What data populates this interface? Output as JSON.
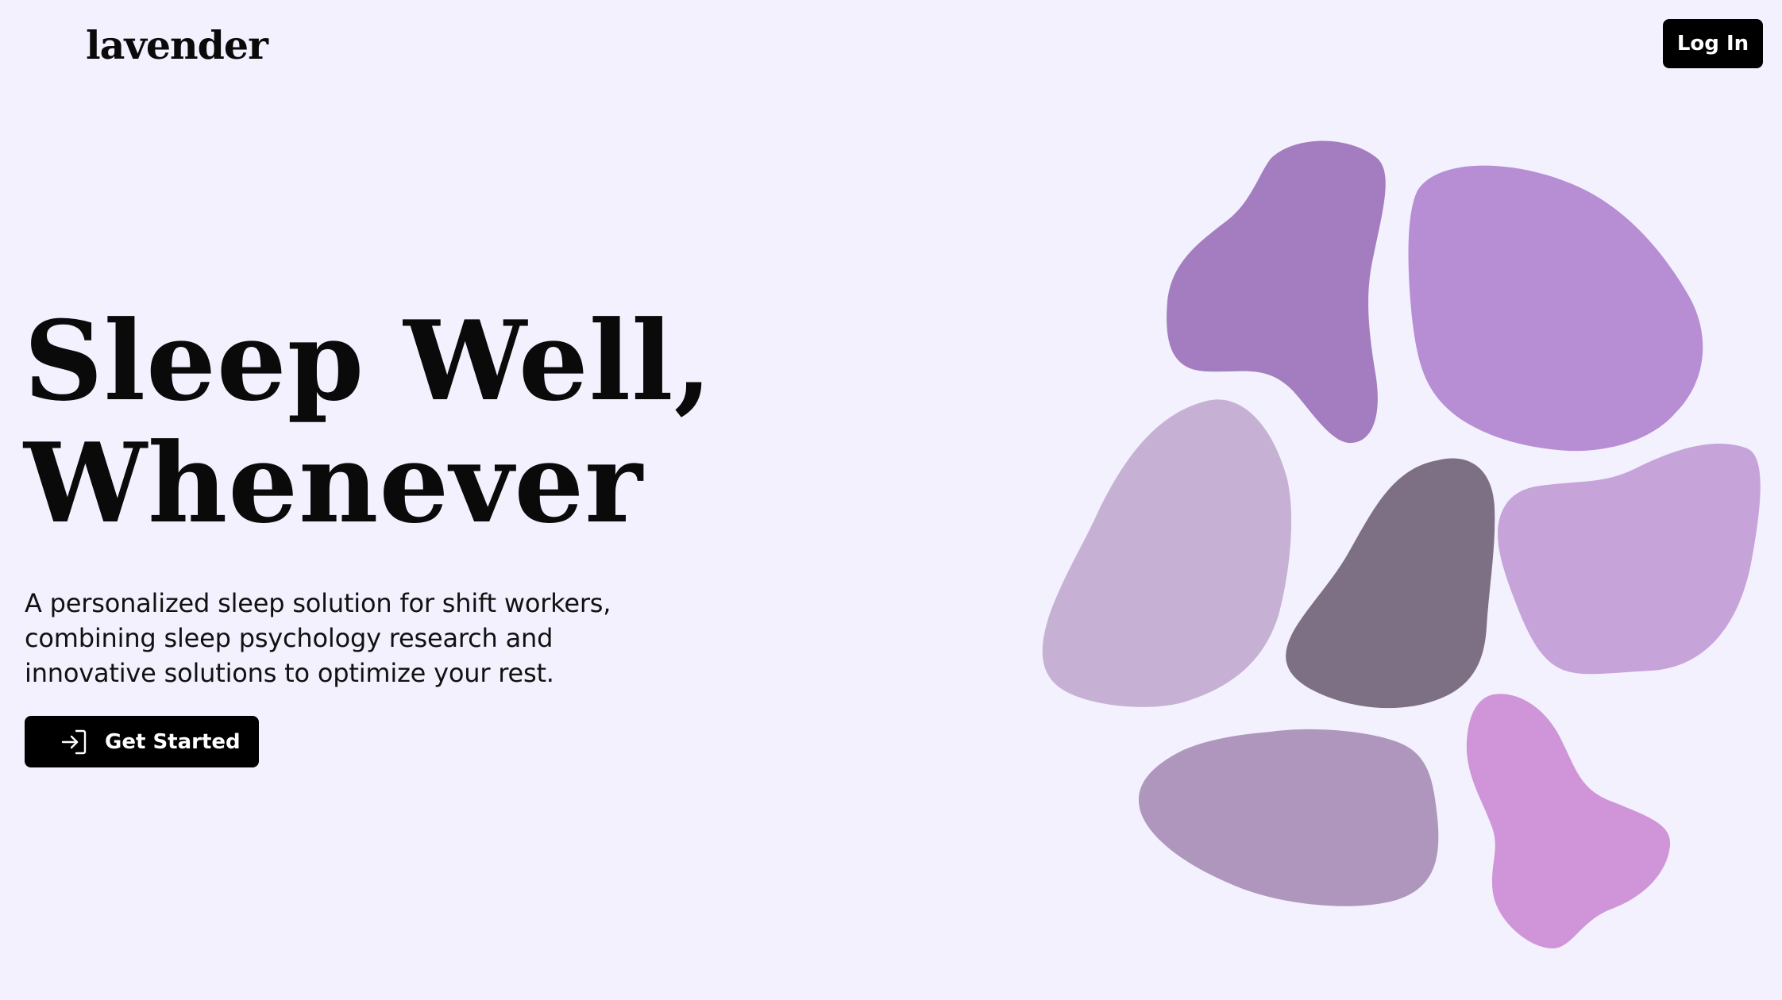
{
  "header": {
    "logo_text": "lavender",
    "login_label": "Log In"
  },
  "hero": {
    "title_line1": "Sleep Well,",
    "title_line2": "Whenever",
    "subtitle": "A personalized sleep solution for shift workers, combining sleep psychology research and innovative solutions to optimize your rest.",
    "cta_label": "Get Started",
    "cta_icon": "login-arrow-icon"
  },
  "colors": {
    "background": "#f3f1fd",
    "button": "#000000",
    "blob_top_left": "#a37dbf",
    "blob_top_right": "#b78dd4",
    "blob_mid_left": "#c6b1d4",
    "blob_center": "#7e7084",
    "blob_mid_right": "#c6a3d9",
    "blob_bottom_left": "#af96bd",
    "blob_bottom_right": "#cf95d8"
  }
}
